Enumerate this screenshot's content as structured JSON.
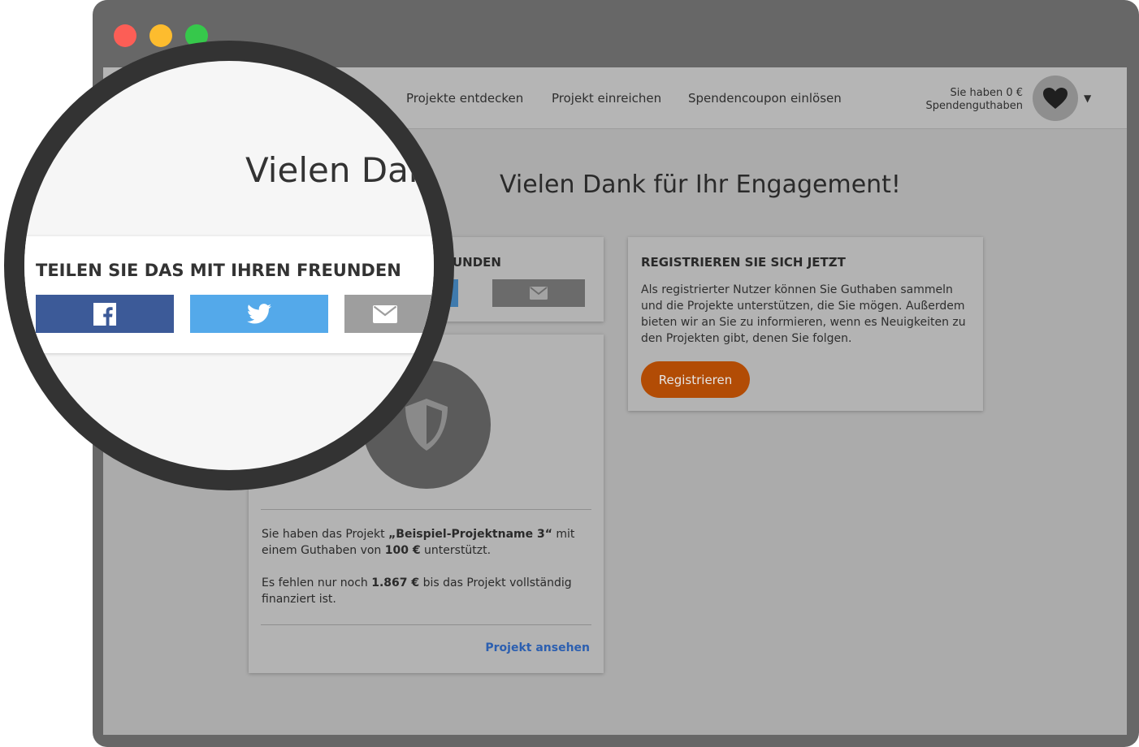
{
  "nav": {
    "links": [
      "Projekte entdecken",
      "Projekt einreichen",
      "Spendencoupon einlösen"
    ],
    "credit_line1": "Sie haben 0 €",
    "credit_line2": "Spendenguthaben",
    "avatar_icon": "heart-icon",
    "dropdown_icon": "caret-down-icon"
  },
  "page": {
    "title": "Vielen Dank für Ihr Engagement!"
  },
  "share": {
    "heading": "TEILEN SIE DAS MIT IHREN FREUNDEN",
    "heading_partial": "UNDEN",
    "buttons": [
      "facebook-icon",
      "twitter-icon",
      "envelope-icon"
    ]
  },
  "project": {
    "icon": "shield-icon",
    "text1_a": "Sie haben das Projekt ",
    "text1_name": "„Beispiel-Projektname 3“",
    "text1_b": " mit einem Guthaben von ",
    "text1_amount": "100 €",
    "text1_c": " unterstützt.",
    "text2_a": "Es fehlen nur noch ",
    "text2_amount": "1.867 €",
    "text2_b": " bis das Projekt vollständig finanziert ist.",
    "link": "Projekt ansehen"
  },
  "register": {
    "heading": "REGISTRIEREN SIE SICH JETZT",
    "body": "Als registrierter Nutzer können Sie Guthaben sammeln und die Projekte unterstützen, die Sie mögen. Außerdem bieten wir an Sie zu informieren, wenn es Neuigkeiten zu den Projekten gibt, denen Sie folgen.",
    "button": "Registrieren"
  },
  "magnifier": {
    "title": "Vielen Dank für Ihr Engagement!"
  },
  "colors": {
    "facebook": "#3c5a98",
    "twitter": "#54a9ea",
    "mail": "#9e9e9e",
    "register": "#b24c05",
    "link": "#2c5fb0"
  }
}
